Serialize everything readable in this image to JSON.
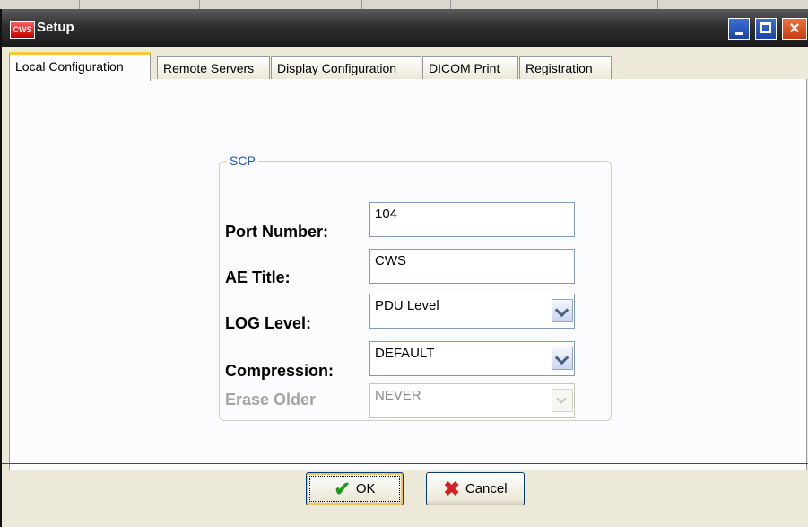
{
  "window": {
    "title": "Setup",
    "app_icon_text": "CWS"
  },
  "tabs": [
    {
      "label": "Local Configuration",
      "active": true
    },
    {
      "label": "Remote Servers",
      "active": false
    },
    {
      "label": "Display Configuration",
      "active": false
    },
    {
      "label": "DICOM Print",
      "active": false
    },
    {
      "label": "Registration",
      "active": false
    }
  ],
  "scp": {
    "legend": "SCP",
    "port": {
      "label": "Port Number:",
      "value": "104"
    },
    "ae_title": {
      "label": "AE Title:",
      "value": "CWS"
    },
    "log_level": {
      "label": "LOG Level:",
      "value": "PDU Level"
    },
    "compression": {
      "label": "Compression:",
      "value": "DEFAULT"
    },
    "erase_older": {
      "label": "Erase Older",
      "value": "NEVER",
      "enabled": false
    }
  },
  "buttons": {
    "ok": "OK",
    "cancel": "Cancel"
  },
  "colors": {
    "titlebar": "#1a1a1a",
    "active_tab_accent": "#ffc83c",
    "group_legend": "#1d57b8"
  },
  "icons": [
    "cws-app-icon",
    "minimize-icon",
    "maximize-icon",
    "close-icon",
    "check-icon",
    "cancel-x-icon",
    "chevron-down-icon"
  ]
}
